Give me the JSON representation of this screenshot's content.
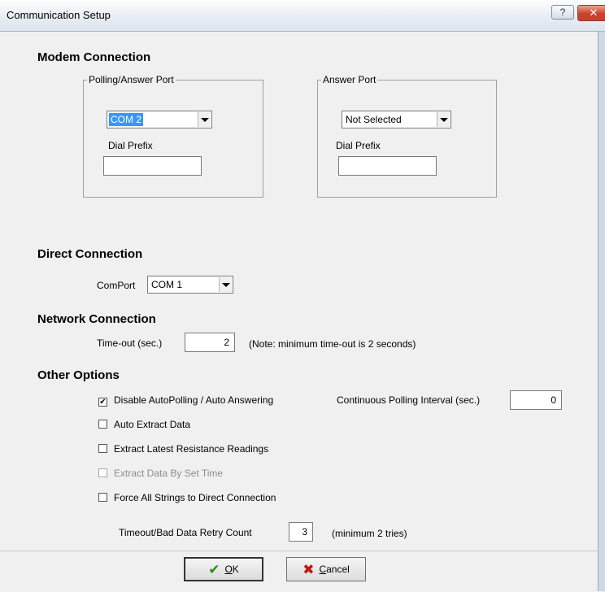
{
  "window": {
    "title": "Communication Setup",
    "help_glyph": "?",
    "close_glyph": "✕"
  },
  "modem": {
    "heading": "Modem Connection",
    "polling": {
      "group_label": "Polling/Answer Port",
      "port_value": "COM 2",
      "dial_prefix_label": "Dial Prefix",
      "dial_prefix_value": ""
    },
    "answer": {
      "group_label": "Answer Port",
      "port_value": "Not Selected",
      "dial_prefix_label": "Dial Prefix",
      "dial_prefix_value": ""
    }
  },
  "direct": {
    "heading": "Direct Connection",
    "comport_label": "ComPort",
    "comport_value": "COM 1"
  },
  "network": {
    "heading": "Network Connection",
    "timeout_label": "Time-out (sec.)",
    "timeout_value": "2",
    "note": "(Note: minimum time-out is 2 seconds)"
  },
  "other": {
    "heading": "Other Options",
    "checkboxes": [
      {
        "label": "Disable AutoPolling / Auto Answering",
        "checked": true,
        "enabled": true
      },
      {
        "label": "Auto Extract Data",
        "checked": false,
        "enabled": true
      },
      {
        "label": "Extract Latest Resistance Readings",
        "checked": false,
        "enabled": true
      },
      {
        "label": "Extract Data By Set Time",
        "checked": false,
        "enabled": false
      },
      {
        "label": "Force All Strings to Direct Connection",
        "checked": false,
        "enabled": true
      }
    ],
    "polling_interval_label": "Continuous Polling Interval (sec.)",
    "polling_interval_value": "0",
    "retry_label": "Timeout/Bad Data Retry Count",
    "retry_value": "3",
    "retry_note": "(minimum 2 tries)"
  },
  "buttons": {
    "ok_accel": "O",
    "ok_rest": "K",
    "cancel_accel": "C",
    "cancel_rest": "ancel"
  },
  "icons": {
    "ok": "checkmark-icon",
    "cancel": "x-icon",
    "ok_color": "#2d8a1e",
    "cancel_color": "#c0180b"
  }
}
